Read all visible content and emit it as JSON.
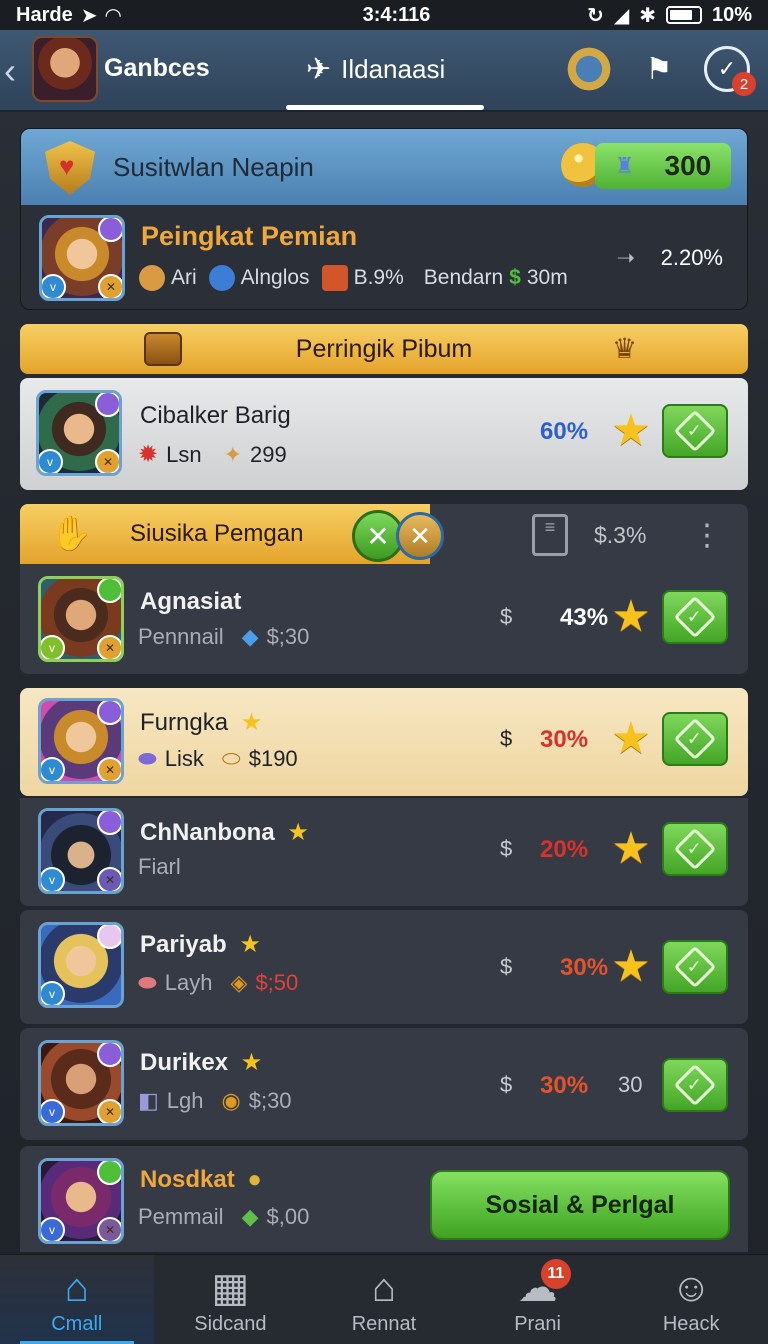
{
  "status_bar": {
    "carrier": "Harde",
    "time": "3:4:116",
    "battery": "10%"
  },
  "header": {
    "title": "Ganbces",
    "tab": "Ildanaasi",
    "notification_count": "2"
  },
  "profile": {
    "heading": "Susitwlan Neapin",
    "score": "300",
    "rank_name": "Peingkat Pemian",
    "stats": {
      "a": "Ari",
      "b": "Alnglos",
      "c": "B.9%",
      "d": "Bendarn",
      "e": "30m"
    },
    "rank_percent": "2.20%"
  },
  "section_title": "Perringik Pibum",
  "featured": {
    "name": "Cibalker Barig",
    "sub_a": "Lsn",
    "sub_b": "299",
    "percent": "60%"
  },
  "sub_section": {
    "title": "Siusika Pemgan",
    "percent": "$.3%"
  },
  "players": [
    {
      "name": "Agnasiat",
      "sub_a": "Pennnail",
      "sub_b": "$;30",
      "dollar": "$",
      "percent": "43%"
    },
    {
      "name": "Furngka",
      "sub_a": "Lisk",
      "sub_b": "$190",
      "dollar": "$",
      "percent": "30%"
    },
    {
      "name": "ChNanbona",
      "sub_a": "Fiarl",
      "sub_b": "",
      "dollar": "$",
      "percent": "20%"
    },
    {
      "name": "Pariyab",
      "sub_a": "Layh",
      "sub_b": "$;50",
      "dollar": "$",
      "percent": "30%"
    },
    {
      "name": "Durikex",
      "sub_a": "Lgh",
      "sub_b": "$;30",
      "dollar": "$",
      "percent": "30%",
      "extra": "30"
    },
    {
      "name": "Nosdkat",
      "sub_a": "Pemmail",
      "sub_b": "$,00"
    }
  ],
  "action_button": "Sosial & Perlgal",
  "nav": [
    {
      "label": "Cmall"
    },
    {
      "label": "Sidcand"
    },
    {
      "label": "Rennat"
    },
    {
      "label": "Prani",
      "badge": "11"
    },
    {
      "label": "Heack"
    }
  ],
  "colors": {
    "accent_green": "#4fb233",
    "accent_gold": "#e4a32b",
    "pct_blue": "#2d5fd0",
    "pct_red": "#d8322a",
    "nav_active": "#3da9ef"
  }
}
